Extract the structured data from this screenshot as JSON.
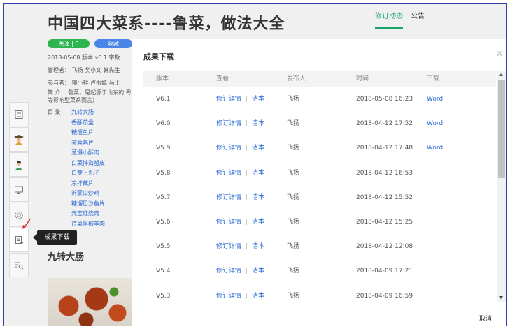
{
  "page": {
    "title": "中国四大菜系----鲁菜，做法大全",
    "tabs": [
      "修订动态",
      "公告"
    ],
    "follow_label": "关注 | 0",
    "collect_label": "收藏",
    "meta_line1": "2018-05-08   版本 v6.1   字数",
    "meta_line2": "管理者：  飞扬   奖小文   韩先生",
    "meta_line3": "参与者：  邬小祥   卢振嬉   马士",
    "meta_line4": "简   介：  鲁菜，是起源于山东的 粤等影响型菜系而言）",
    "toc_label": "目   录：",
    "toc": [
      "九转大肠",
      "香酥茄盒",
      "糖溜鱼片",
      "芙蓉鸡片",
      "葱爆小酥肉",
      "白菜拌海蜇皮",
      "白萝卜丸子",
      "凉拌藕片",
      "沂蒙山炒鸡",
      "糖熘巴沙鱼片",
      "元宝红烧肉",
      "芹菜黑椒羊肉"
    ],
    "section_title": "九转大肠"
  },
  "toolbar": {
    "icons": [
      "list-icon",
      "student-icon",
      "teacher-icon",
      "monitor-icon",
      "settings-icon",
      "download-doc-icon",
      "search-list-icon"
    ],
    "tooltip": "成果下载"
  },
  "modal": {
    "title": "成果下载",
    "close": "×",
    "columns": [
      "版本",
      "查看",
      "发布人",
      "时间",
      "下载"
    ],
    "rows": [
      {
        "version": "V6.1",
        "detail": "修订详情",
        "sep": "|",
        "clean": "洁本",
        "publisher": "飞扬",
        "time": "2018-05-08 16:23",
        "download": "Word"
      },
      {
        "version": "V6.0",
        "detail": "修订详情",
        "sep": "|",
        "clean": "洁本",
        "publisher": "飞扬",
        "time": "2018-04-12 17:52",
        "download": "Word"
      },
      {
        "version": "V5.9",
        "detail": "修订详情",
        "sep": "|",
        "clean": "洁本",
        "publisher": "飞扬",
        "time": "2018-04-12 17:48",
        "download": "Word"
      },
      {
        "version": "V5.8",
        "detail": "修订详情",
        "sep": "|",
        "clean": "洁本",
        "publisher": "飞扬",
        "time": "2018-04-12 16:53",
        "download": ""
      },
      {
        "version": "V5.7",
        "detail": "修订详情",
        "sep": "|",
        "clean": "洁本",
        "publisher": "飞扬",
        "time": "2018-04-12 15:52",
        "download": ""
      },
      {
        "version": "V5.6",
        "detail": "修订详情",
        "sep": "|",
        "clean": "洁本",
        "publisher": "飞扬",
        "time": "2018-04-12 15:25",
        "download": ""
      },
      {
        "version": "V5.5",
        "detail": "修订详情",
        "sep": "|",
        "clean": "洁本",
        "publisher": "飞扬",
        "time": "2018-04-12 12:08",
        "download": ""
      },
      {
        "version": "V5.4",
        "detail": "修订详情",
        "sep": "|",
        "clean": "洁本",
        "publisher": "飞扬",
        "time": "2018-04-09 17:21",
        "download": ""
      },
      {
        "version": "V5.3",
        "detail": "修订详情",
        "sep": "|",
        "clean": "洁本",
        "publisher": "飞扬",
        "time": "2018-04-09 16:59",
        "download": ""
      }
    ],
    "cancel_label": "取消"
  },
  "colors": {
    "accent_green": "#1aa36a",
    "link_blue": "#2a6ad4",
    "follow_green": "#2db350",
    "collect_blue": "#4a86e8",
    "annotation_red": "#e02020"
  }
}
